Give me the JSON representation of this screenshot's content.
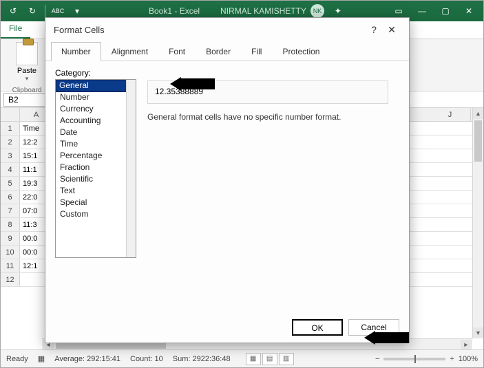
{
  "titlebar": {
    "doc": "Book1 - Excel",
    "user": "NIRMAL KAMISHETTY",
    "avatar": "NK"
  },
  "ribbon": {
    "file": "File",
    "paste": "Paste",
    "clipboard_label": "Clipboard"
  },
  "name_box": "B2",
  "columns": {
    "a": "A",
    "j": "J"
  },
  "rows": {
    "header_a": "Time",
    "r1": "12:2",
    "r2": "15:1",
    "r3": "11:1",
    "r4": "19:3",
    "r5": "22:0",
    "r6": "07:0",
    "r7": "11:3",
    "r8": "00:0",
    "r9": "00:0",
    "r10": "12:1"
  },
  "status": {
    "ready": "Ready",
    "avg_label": "Average:",
    "avg_val": "292:15:41",
    "count_label": "Count:",
    "count_val": "10",
    "sum_label": "Sum:",
    "sum_val": "2922:36:48",
    "zoom": "100%"
  },
  "dialog": {
    "title": "Format Cells",
    "tabs": {
      "number": "Number",
      "alignment": "Alignment",
      "font": "Font",
      "border": "Border",
      "fill": "Fill",
      "protection": "Protection"
    },
    "category_label": "Category:",
    "categories": {
      "general": "General",
      "number": "Number",
      "currency": "Currency",
      "accounting": "Accounting",
      "date": "Date",
      "time": "Time",
      "percentage": "Percentage",
      "fraction": "Fraction",
      "scientific": "Scientific",
      "text": "Text",
      "special": "Special",
      "custom": "Custom"
    },
    "sample_value": "12.35388889",
    "description": "General format cells have no specific number format.",
    "ok": "OK",
    "cancel": "Cancel"
  }
}
